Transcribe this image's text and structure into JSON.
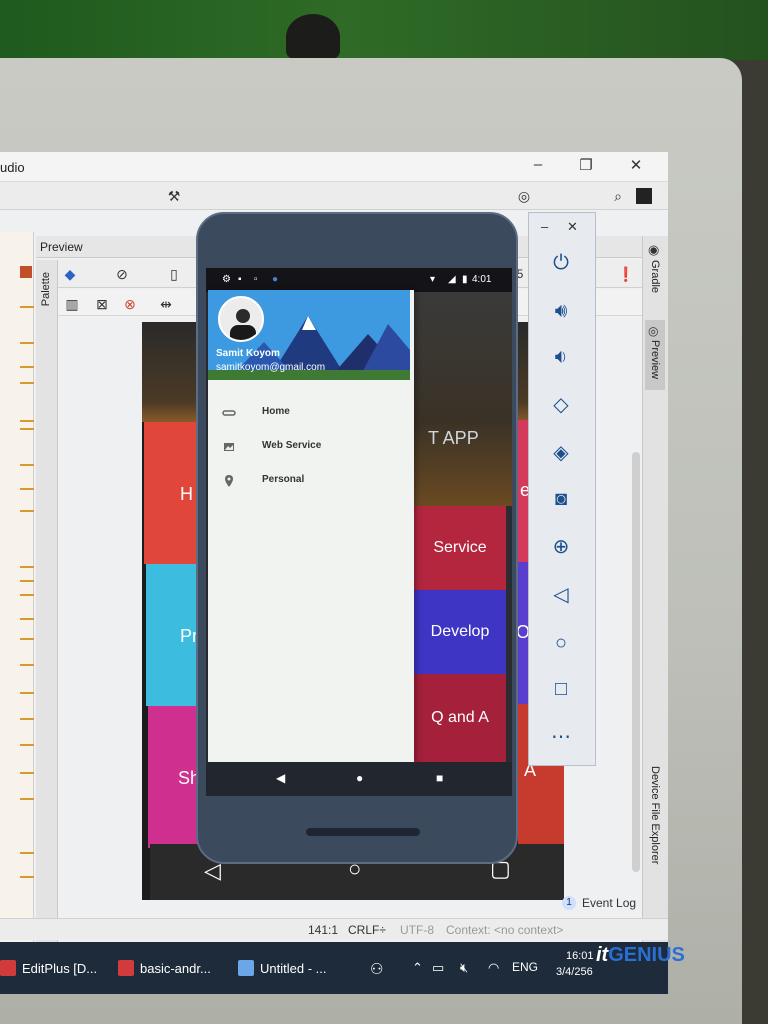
{
  "ide": {
    "app_title": "udio",
    "win_min": "–",
    "win_max": "❐",
    "win_close": "✕",
    "preview_title": "Preview",
    "palette_label": "Palette",
    "gradle_label": "Gradle",
    "preview_side_label": "Preview",
    "device_file_label": "Device File Explorer",
    "event_log_badge": "1",
    "event_log": "Event Log",
    "status_position": "141:1",
    "status_crlf": "CRLF÷",
    "status_encoding": "UTF-8",
    "status_context": "Context: <no context>",
    "toolbar_number": "5"
  },
  "design_preview": {
    "tiles": [
      {
        "label": "H",
        "color": "#e0473a"
      },
      {
        "label": "Pr",
        "color": "#3cbde0"
      },
      {
        "label": "Sh",
        "color": "#cf2f8f"
      },
      {
        "label": "e",
        "color": "#d43a5c"
      },
      {
        "label": "Op",
        "color": "#5a3fcf"
      },
      {
        "label": "A",
        "color": "#c63b2d"
      }
    ],
    "app_label": "T APP"
  },
  "emulator": {
    "time": "4:01",
    "user_name": "Samit Koyom",
    "user_email": "samitkoyom@gmail.com",
    "menu": [
      {
        "label": "Home",
        "icon": "link-icon"
      },
      {
        "label": "Web Service",
        "icon": "image-icon"
      },
      {
        "label": "Personal",
        "icon": "location-icon"
      }
    ],
    "bg_tiles": [
      {
        "label": "Service",
        "color": "#b3263e"
      },
      {
        "label": "Develop",
        "color": "#3e35c4"
      },
      {
        "label": "Q and A",
        "color": "#a5203a"
      }
    ],
    "controls": [
      "power-icon",
      "volume-up-icon",
      "volume-down-icon",
      "rotate-left-icon",
      "rotate-right-icon",
      "camera-icon",
      "zoom-icon",
      "back-icon",
      "home-icon",
      "overview-icon",
      "more-icon"
    ]
  },
  "taskbar": {
    "items": [
      {
        "label": "EditPlus [D...",
        "icon_color": "#d23b3b"
      },
      {
        "label": "basic-andr...",
        "icon_color": "#d23b3b"
      },
      {
        "label": "Untitled - ...",
        "icon_color": "#6aa6e8"
      }
    ],
    "language": "ENG",
    "time": "16:01",
    "date": "3/4/256"
  },
  "watermark": {
    "it": "it",
    "genius": "GENIUS"
  }
}
